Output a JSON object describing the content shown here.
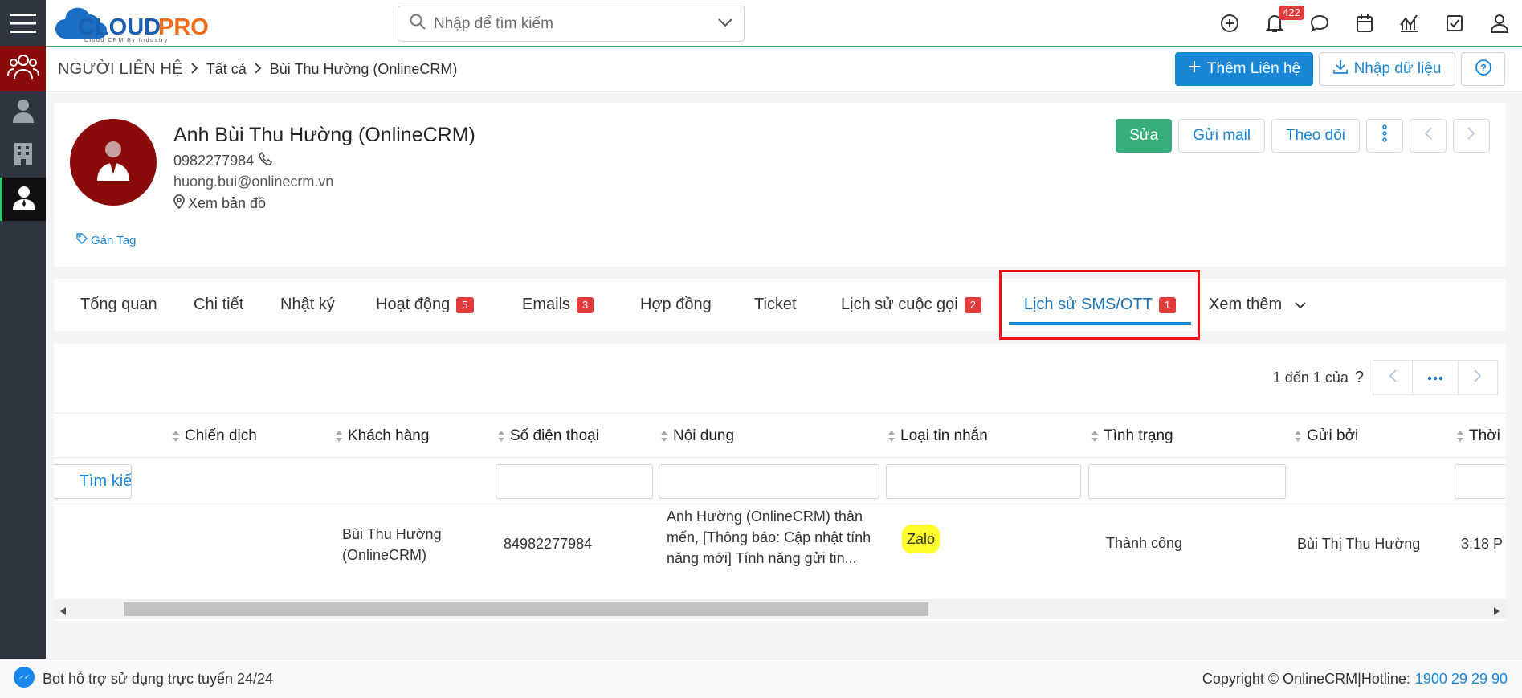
{
  "app": {
    "logo_text": "CLOUDPRO",
    "logo_sub": "Cloud CRM By Industry"
  },
  "search": {
    "placeholder": "Nhập để tìm kiếm"
  },
  "header": {
    "notification_count": "422"
  },
  "breadcrumb": {
    "root": "NGƯỜI LIÊN HỆ",
    "level1": "Tất cả",
    "level2": "Bùi Thu Hường (OnlineCRM)"
  },
  "actions": {
    "add_label": "Thêm Liên hệ",
    "import_label": "Nhập dữ liệu"
  },
  "profile": {
    "name": "Anh Bùi Thu Hường (OnlineCRM)",
    "phone": "0982277984",
    "email": "huong.bui@onlinecrm.vn",
    "map": "Xem bản đồ",
    "tag": "Gán Tag",
    "edit": "Sửa",
    "send_mail": "Gửi mail",
    "follow": "Theo dõi"
  },
  "tabs": [
    {
      "label": "Tổng quan",
      "count": ""
    },
    {
      "label": "Chi tiết",
      "count": ""
    },
    {
      "label": "Nhật ký",
      "count": ""
    },
    {
      "label": "Hoạt động",
      "count": "5"
    },
    {
      "label": "Emails",
      "count": "3"
    },
    {
      "label": "Hợp đồng",
      "count": ""
    },
    {
      "label": "Ticket",
      "count": ""
    },
    {
      "label": "Lịch sử cuộc gọi",
      "count": "2"
    },
    {
      "label": "Lịch sử SMS/OTT",
      "count": "1"
    },
    {
      "label": "Xem thêm",
      "count": ""
    }
  ],
  "pager": {
    "text": "1 đến 1 của",
    "help": "?"
  },
  "table": {
    "search_label": "Tìm kiếm",
    "headers": [
      "Chiến dịch",
      "Khách hàng",
      "Số điện thoại",
      "Nội dung",
      "Loại tin nhắn",
      "Tình trạng",
      "Gửi bởi",
      "Thời"
    ],
    "row": {
      "customer": "Bùi Thu Hường (OnlineCRM)",
      "phone": "84982277984",
      "content": "Anh Hường (OnlineCRM) thân mến, [Thông báo: Cập nhật tính năng mới] Tính năng gửi tin...",
      "type": "Zalo",
      "status": "Thành công",
      "sender": "Bùi Thị Thu Hường",
      "time": "3:18 P"
    }
  },
  "footer": {
    "bot_text": "Bot hỗ trợ sử dụng trực tuyến 24/24",
    "copyright": "Copyright © OnlineCRM|Hotline:",
    "hotline": "1900 29 29 90"
  },
  "colors": {
    "brand": "#1a87d6",
    "sidebar": "#2e3440",
    "avatar_bg": "#8b0a0a",
    "edit_green": "#36ae7c",
    "badge_red": "#e23b3b",
    "highlight": "#ee1111"
  }
}
